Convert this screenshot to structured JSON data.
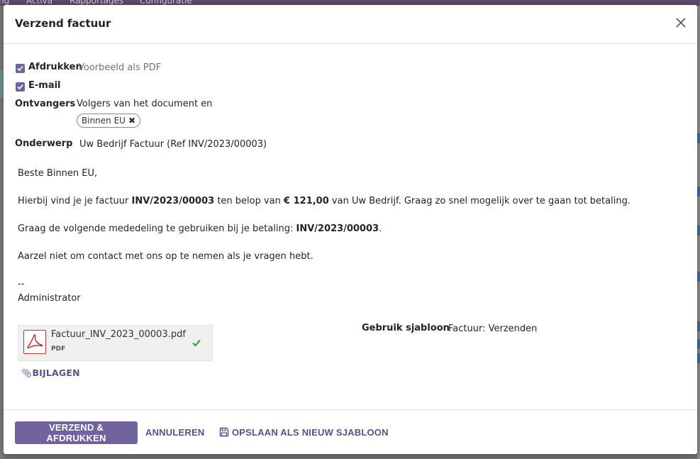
{
  "background": {
    "menu_items": [
      "ng",
      "Activa",
      "Rapportages",
      "Configuratie"
    ]
  },
  "modal": {
    "title": "Verzend factuur"
  },
  "print": {
    "label": "Afdrukken",
    "hint": "Voorbeeld als PDF",
    "checked": true
  },
  "email": {
    "label": "E-mail",
    "checked": true
  },
  "recipients": {
    "label": "Ontvangers",
    "text": "Volgers van het document en",
    "tags": [
      "Binnen EU"
    ]
  },
  "subject": {
    "label": "Onderwerp",
    "value": "Uw Bedrijf Factuur (Ref INV/2023/00003)"
  },
  "body": {
    "greeting": "Beste Binnen EU,",
    "line1_a": "Hierbij vind je je factuur ",
    "line1_invoice": "INV/2023/00003",
    "line1_b": " ten belop van ",
    "line1_amount": "€ 121,00",
    "line1_c": " van Uw Bedrijf. Graag zo snel mogelijk over te gaan tot betaling.",
    "line2_a": "Graag de volgende mededeling te gebruiken bij je betaling: ",
    "line2_ref": "INV/2023/00003",
    "line2_b": ".",
    "line3": "Aarzel niet om contact met ons op te nemen als je vragen hebt.",
    "sig_dash": "--",
    "signature": "Administrator"
  },
  "attachment": {
    "filename": "Factuur_INV_2023_00003.pdf",
    "type": "PDF",
    "icon": "pdf-icon",
    "status_icon": "check-icon"
  },
  "attachments_link": "BIJLAGEN",
  "template": {
    "label": "Gebruik sjabloon",
    "value": "Factuur: Verzenden"
  },
  "footer": {
    "send_print": "VERZEND & AFDRUKKEN",
    "cancel": "ANNULEREN",
    "save_template": "OPSLAAN ALS NIEUW SJABLOON"
  },
  "colors": {
    "primary": "#71639e",
    "link": "#5c4f87",
    "success": "#28a745",
    "pdf_red": "#b03a2e"
  }
}
